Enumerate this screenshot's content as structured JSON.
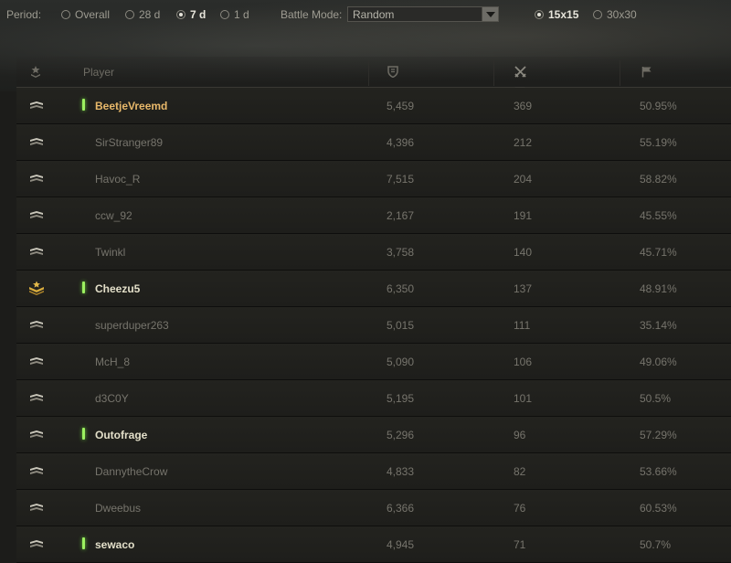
{
  "filters": {
    "period_label": "Period:",
    "periods": [
      {
        "label": "Overall",
        "selected": false
      },
      {
        "label": "28 d",
        "selected": false
      },
      {
        "label": "7 d",
        "selected": true
      },
      {
        "label": "1 d",
        "selected": false
      }
    ],
    "battle_mode_label": "Battle Mode:",
    "battle_mode_value": "Random",
    "formats": [
      {
        "label": "15x15",
        "selected": true
      },
      {
        "label": "30x30",
        "selected": false
      }
    ]
  },
  "table": {
    "columns": {
      "rank": "rank-icon",
      "player": "Player",
      "rating": "shield-icon",
      "battles": "crossed-swords-icon",
      "winrate": "flag-icon"
    },
    "sorted_by": "battles",
    "rows": [
      {
        "player": "BeetjeVreemd",
        "rating": "5,459",
        "battles": "369",
        "winrate": "50.95%",
        "online": true,
        "status": "me",
        "rank": "private"
      },
      {
        "player": "SirStranger89",
        "rating": "4,396",
        "battles": "212",
        "winrate": "55.19%",
        "online": false,
        "status": "normal",
        "rank": "private"
      },
      {
        "player": "Havoc_R",
        "rating": "7,515",
        "battles": "204",
        "winrate": "58.82%",
        "online": false,
        "status": "normal",
        "rank": "private"
      },
      {
        "player": "ccw_92",
        "rating": "2,167",
        "battles": "191",
        "winrate": "45.55%",
        "online": false,
        "status": "normal",
        "rank": "private"
      },
      {
        "player": "Twinkl",
        "rating": "3,758",
        "battles": "140",
        "winrate": "45.71%",
        "online": false,
        "status": "normal",
        "rank": "private"
      },
      {
        "player": "Cheezu5",
        "rating": "6,350",
        "battles": "137",
        "winrate": "48.91%",
        "online": true,
        "status": "friend",
        "rank": "officer"
      },
      {
        "player": "superduper263",
        "rating": "5,015",
        "battles": "111",
        "winrate": "35.14%",
        "online": false,
        "status": "normal",
        "rank": "private"
      },
      {
        "player": "McH_8",
        "rating": "5,090",
        "battles": "106",
        "winrate": "49.06%",
        "online": false,
        "status": "normal",
        "rank": "private"
      },
      {
        "player": "d3C0Y",
        "rating": "5,195",
        "battles": "101",
        "winrate": "50.5%",
        "online": false,
        "status": "normal",
        "rank": "private"
      },
      {
        "player": "Outofrage",
        "rating": "5,296",
        "battles": "96",
        "winrate": "57.29%",
        "online": true,
        "status": "friend",
        "rank": "private"
      },
      {
        "player": "DannytheCrow",
        "rating": "4,833",
        "battles": "82",
        "winrate": "53.66%",
        "online": false,
        "status": "normal",
        "rank": "private"
      },
      {
        "player": "Dweebus",
        "rating": "6,366",
        "battles": "76",
        "winrate": "60.53%",
        "online": false,
        "status": "normal",
        "rank": "private"
      },
      {
        "player": "sewaco",
        "rating": "4,945",
        "battles": "71",
        "winrate": "50.7%",
        "online": true,
        "status": "friend",
        "rank": "private"
      }
    ]
  },
  "colors": {
    "accent_me": "#e8b86a",
    "online_indicator": "#9cf060",
    "friend_name": "#e3dfc9",
    "muted_text": "#76746c"
  }
}
